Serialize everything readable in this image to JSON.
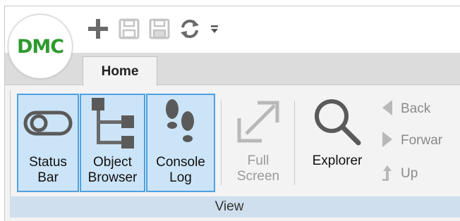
{
  "app": {
    "logo_text": "DMC"
  },
  "quick_access": {
    "icons": [
      "plus-icon",
      "save-icon",
      "save-as-icon",
      "refresh-icon",
      "customize-dropdown-icon"
    ]
  },
  "tabs": {
    "home": "Home"
  },
  "ribbon": {
    "buttons": {
      "status_bar": {
        "line1": "Status",
        "line2": "Bar",
        "state": "active",
        "icon": "toggle-icon"
      },
      "object_browser": {
        "line1": "Object",
        "line2": "Browser",
        "state": "active",
        "icon": "tree-icon"
      },
      "console_log": {
        "line1": "Console",
        "line2": "Log",
        "state": "active",
        "icon": "footprints-icon"
      },
      "full_screen": {
        "line1": "Full",
        "line2": "Screen",
        "state": "disabled",
        "icon": "expand-icon"
      },
      "explorer": {
        "line1": "Explorer",
        "state": "normal",
        "icon": "magnifier-icon"
      }
    },
    "nav": {
      "back": "Back",
      "forward": "Forwar",
      "up": "Up"
    },
    "group_label": "View"
  },
  "colors": {
    "logo_green": "#2e9a2e",
    "active_fill": "#cce4f7",
    "active_border": "#4ea1e0",
    "group_label_bg": "#cfdfee",
    "icon_dark": "#5a5a5a",
    "icon_disabled": "#b8b8b8"
  }
}
